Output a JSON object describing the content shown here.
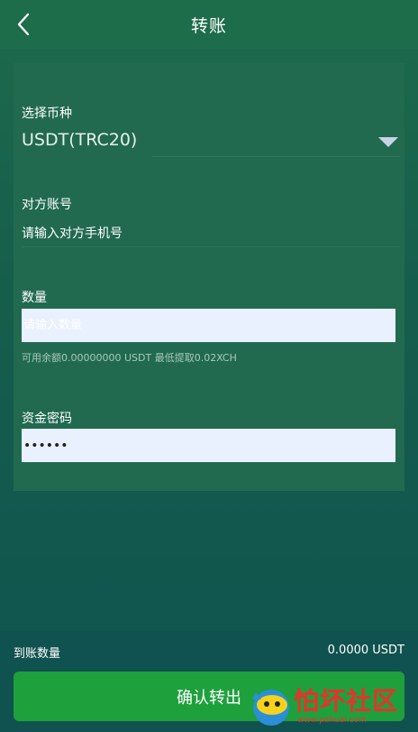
{
  "header": {
    "title": "转账"
  },
  "form": {
    "currency_label": "选择币种",
    "currency_value": "USDT(TRC20)",
    "account_label": "对方账号",
    "account_placeholder": "请输入对方手机号",
    "amount_label": "数量",
    "amount_placeholder": "请输入数量",
    "balance_hint": "可用余额0.00000000 USDT 最低提取0.02XCH",
    "password_label": "资金密码",
    "password_value": "••••••"
  },
  "footer": {
    "arrive_label": "到账数量",
    "arrive_value": "0.0000 USDT",
    "confirm_label": "确认转出"
  },
  "watermark": {
    "text": "怕坏社区",
    "url": "www.pahuai.com"
  },
  "colors": {
    "header_bg": "#1d6c4a",
    "card_bg": "#216a50",
    "button_bg": "#1ea03c",
    "input_bg": "#e9f1fe"
  }
}
